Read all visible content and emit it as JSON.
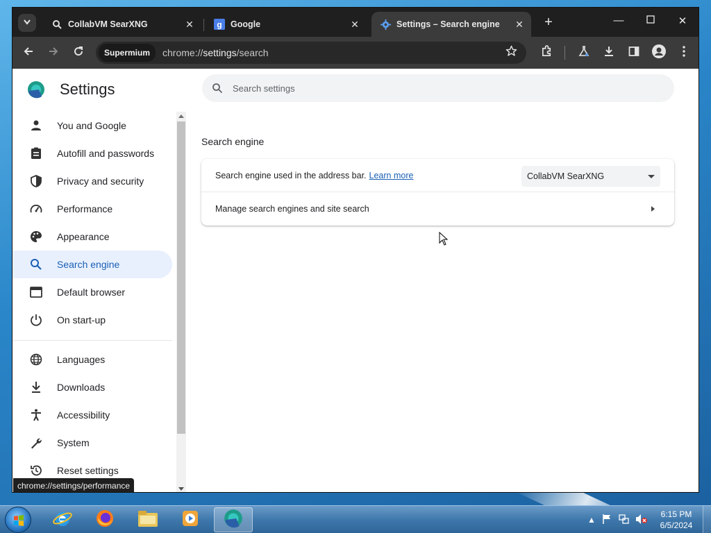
{
  "tabs": [
    {
      "title": "CollabVM SearXNG",
      "icon": "searxng-icon",
      "active": false
    },
    {
      "title": "Google",
      "icon": "google-icon",
      "active": false
    },
    {
      "title": "Settings – Search engine",
      "icon": "gear-icon",
      "active": true
    }
  ],
  "toolbar": {
    "profile_chip": "Supermium",
    "url_scheme": "chrome://",
    "url_host": "settings",
    "url_path": "/search"
  },
  "page": {
    "title": "Settings",
    "search_placeholder": "Search settings",
    "section_title": "Search engine",
    "row1_label": "Search engine used in the address bar.",
    "row1_link": "Learn more",
    "row1_value": "CollabVM SearXNG",
    "row2_label": "Manage search engines and site search"
  },
  "nav": [
    {
      "label": "You and Google",
      "icon": "person-icon"
    },
    {
      "label": "Autofill and passwords",
      "icon": "clipboard-icon"
    },
    {
      "label": "Privacy and security",
      "icon": "shield-icon"
    },
    {
      "label": "Performance",
      "icon": "speedometer-icon"
    },
    {
      "label": "Appearance",
      "icon": "palette-icon"
    },
    {
      "label": "Search engine",
      "icon": "search-icon",
      "active": true
    },
    {
      "label": "Default browser",
      "icon": "browser-window-icon"
    },
    {
      "label": "On start-up",
      "icon": "power-icon"
    },
    {
      "label": "Languages",
      "icon": "globe-icon"
    },
    {
      "label": "Downloads",
      "icon": "download-icon"
    },
    {
      "label": "Accessibility",
      "icon": "accessibility-icon"
    },
    {
      "label": "System",
      "icon": "wrench-icon"
    },
    {
      "label": "Reset settings",
      "icon": "history-icon"
    }
  ],
  "status_url": "chrome://settings/performance",
  "taskbar": {
    "time": "6:15 PM",
    "date": "6/5/2024",
    "apps": [
      "internet-explorer-icon",
      "firefox-icon",
      "file-explorer-icon",
      "media-player-icon",
      "supermium-icon"
    ]
  },
  "colors": {
    "accent": "#1a5fb4",
    "active_nav_bg": "#e8f0fe",
    "tabbar_bg": "#1f1f1f",
    "toolbar_bg": "#3b3b3b"
  }
}
